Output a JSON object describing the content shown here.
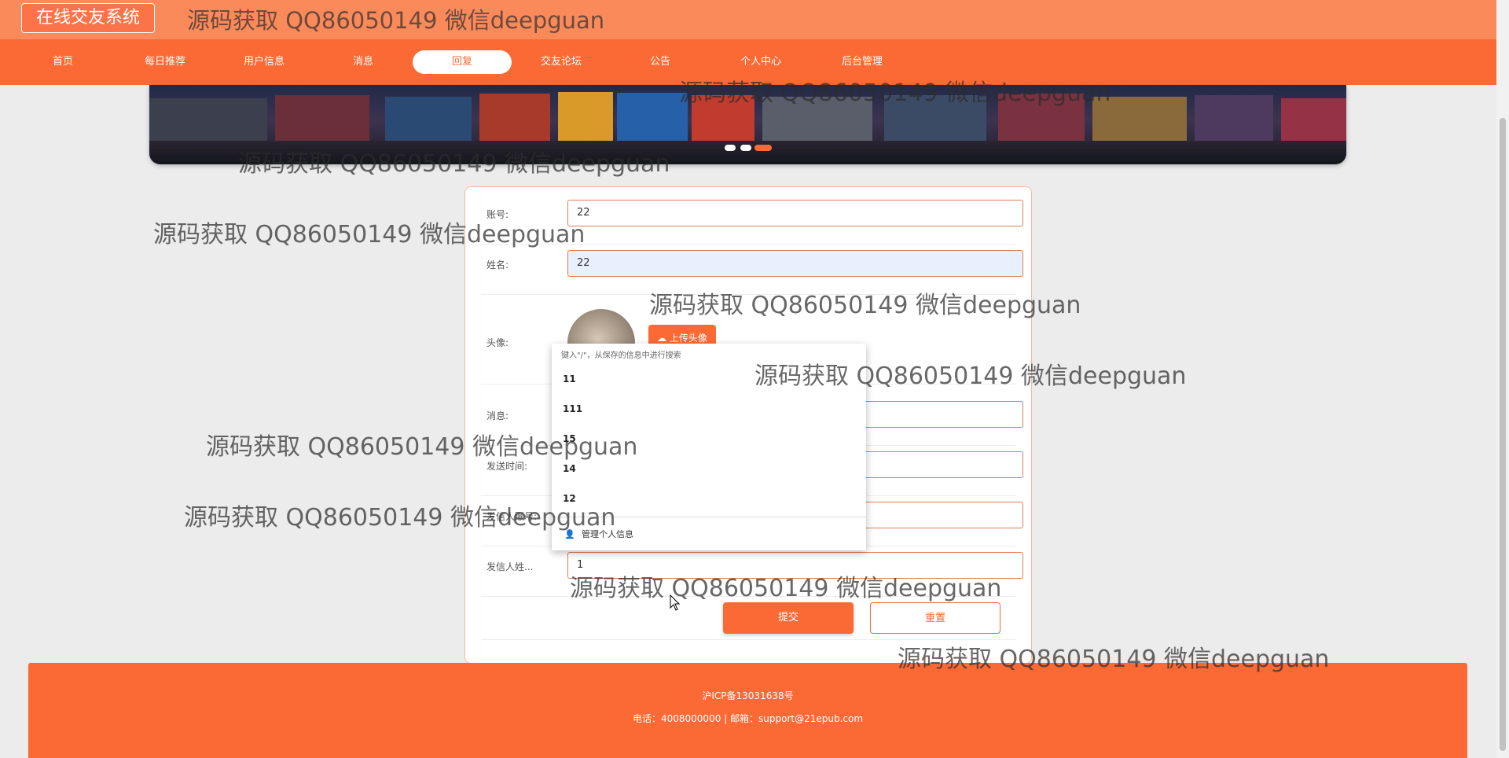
{
  "header": {
    "brand": "在线交友系统",
    "watermark": "源码获取 QQ86050149 微信deepguan"
  },
  "nav": {
    "items": [
      "首页",
      "每日推荐",
      "用户信息",
      "消息",
      "回复",
      "交友论坛",
      "公告",
      "个人中心",
      "后台管理"
    ],
    "active_index": 4
  },
  "banner": {
    "slides": 3,
    "active_slide": 2
  },
  "form": {
    "account": {
      "label": "账号:",
      "value": "22"
    },
    "name": {
      "label": "姓名:",
      "value": "22"
    },
    "avatar": {
      "label": "头像:",
      "upload_label": "上传头像"
    },
    "message": {
      "label": "消息:",
      "value": ""
    },
    "send_time": {
      "label": "发送时间:",
      "value": ""
    },
    "sender_account": {
      "label": "发信人账号:",
      "value": ""
    },
    "sender_name": {
      "label": "发信人姓...",
      "value": "1"
    },
    "submit_label": "提交",
    "reset_label": "重置"
  },
  "autocomplete": {
    "hint": "键入\"/\"，从保存的信息中进行搜索",
    "items": [
      "11",
      "111",
      "15",
      "14",
      "12"
    ],
    "manage_label": "管理个人信息"
  },
  "footer": {
    "icp": "沪ICP备13031638号",
    "contact": "电话：4008000000 | 邮箱：support@21epub.com"
  },
  "watermark_text": "源码获取 QQ86050149 微信deepguan",
  "colors": {
    "primary": "#fb6a35",
    "topbar": "#fb8a5b",
    "background": "#ececec"
  }
}
